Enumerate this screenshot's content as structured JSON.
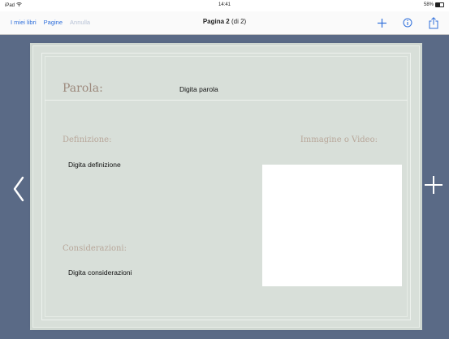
{
  "status_bar": {
    "device": "iPad",
    "time": "14:41",
    "battery": "58%"
  },
  "nav": {
    "my_books": "I miei libri",
    "pages": "Pagine",
    "undo": "Annulla",
    "title_main": "Pagina 2",
    "title_sub": "(di 2)"
  },
  "page": {
    "word_label": "Parola:",
    "word_placeholder": "Digita parola",
    "definition_label": "Definizione:",
    "definition_placeholder": "Digita definizione",
    "media_label": "Immagine o Video:",
    "notes_label": "Considerazioni:",
    "notes_placeholder": "Digita considerazioni"
  },
  "colors": {
    "accent": "#2f6fdb",
    "workspace_bg": "#5a6a86",
    "page_bg": "#d8dfd9",
    "label_color": "#b8a79a"
  },
  "icons": [
    "wifi-icon",
    "battery-icon",
    "add-icon",
    "info-icon",
    "share-icon",
    "chevron-left-icon",
    "plus-icon"
  ]
}
